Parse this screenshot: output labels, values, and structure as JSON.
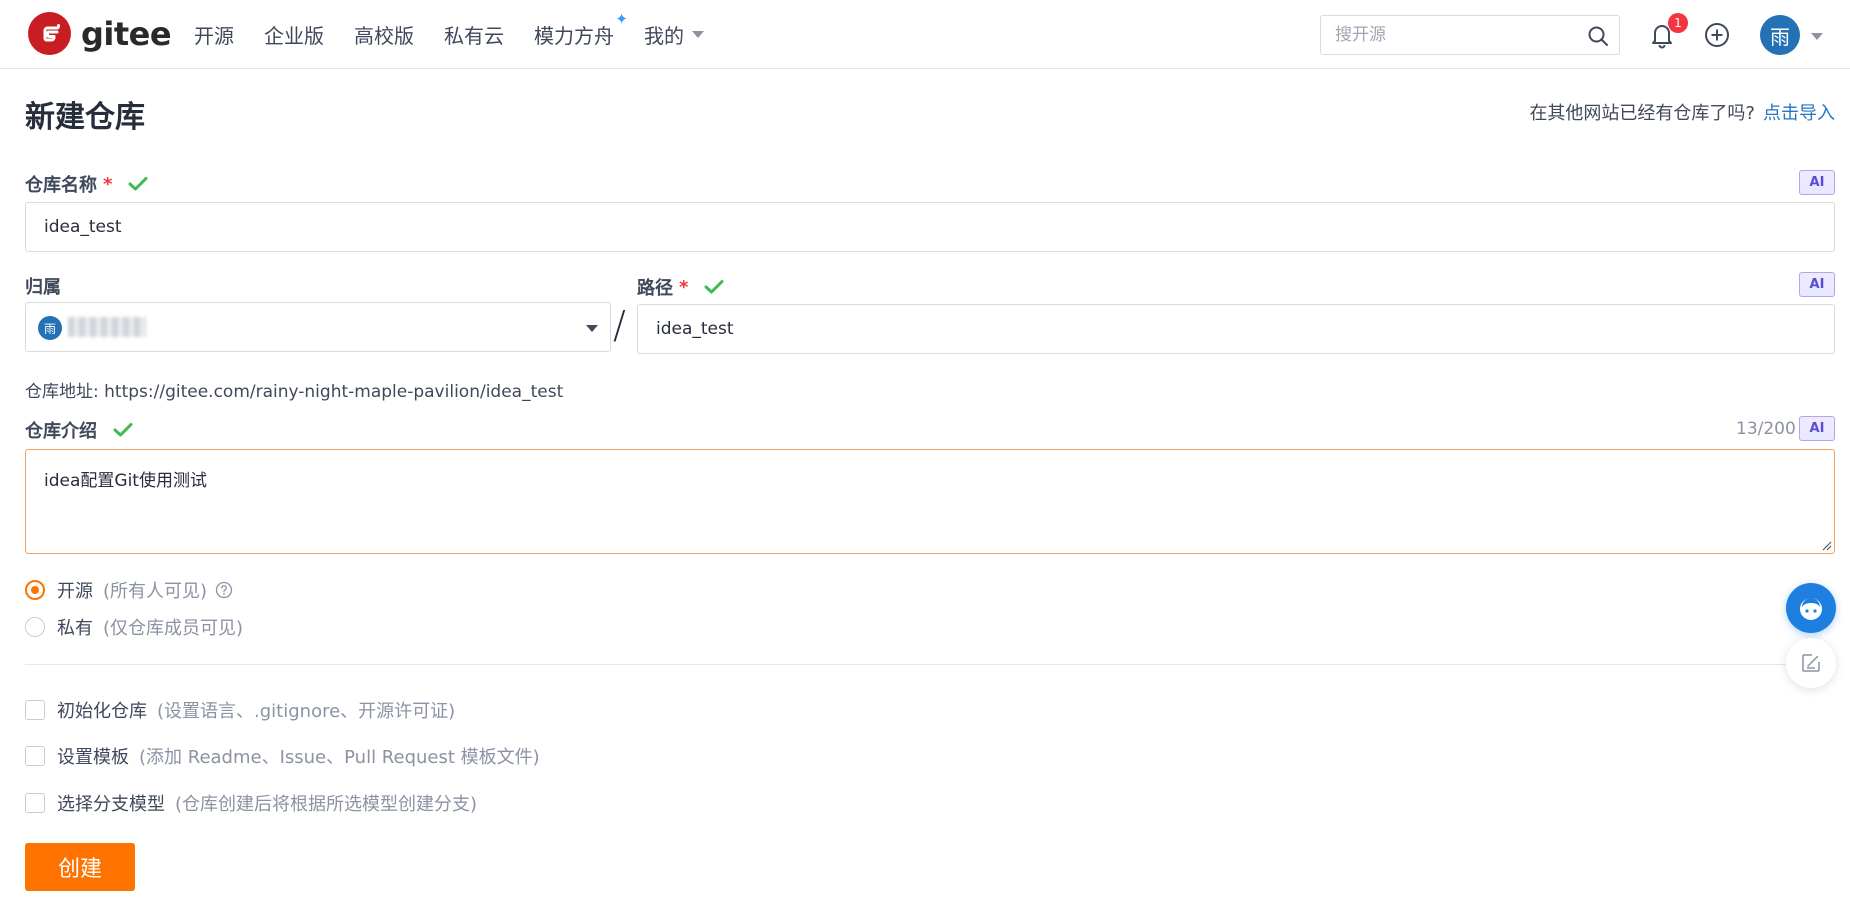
{
  "header": {
    "logo_text": "gitee",
    "nav": [
      {
        "label": "开源"
      },
      {
        "label": "企业版"
      },
      {
        "label": "高校版"
      },
      {
        "label": "私有云"
      },
      {
        "label": "模力方舟",
        "spark": "✦"
      },
      {
        "label": "我的"
      }
    ],
    "search_placeholder": "搜开源",
    "notification_count": "1",
    "user_avatar_text": "雨"
  },
  "page": {
    "title": "新建仓库",
    "import_hint": "在其他网站已经有仓库了吗?",
    "import_link": "点击导入"
  },
  "form": {
    "ai_tag": "AI",
    "repo_name": {
      "label": "仓库名称",
      "required": "*",
      "value": "idea_test"
    },
    "owner": {
      "label": "归属",
      "avatar_text": "雨"
    },
    "slash": "/",
    "path": {
      "label": "路径",
      "required": "*",
      "value": "idea_test"
    },
    "repo_url": "仓库地址: https://gitee.com/rainy-night-maple-pavilion/idea_test",
    "description": {
      "label": "仓库介绍",
      "value": "idea配置Git使用测试",
      "counter": "13/200"
    },
    "visibility": [
      {
        "label": "开源",
        "hint": "(所有人可见)",
        "selected": true
      },
      {
        "label": "私有",
        "hint": "(仅仓库成员可见)",
        "selected": false
      }
    ],
    "options": [
      {
        "label": "初始化仓库",
        "hint": "(设置语言、.gitignore、开源许可证)"
      },
      {
        "label": "设置模板",
        "hint": "(添加 Readme、Issue、Pull Request 模板文件)"
      },
      {
        "label": "选择分支模型",
        "hint": "(仓库创建后将根据所选模型创建分支)"
      }
    ],
    "submit_label": "创建"
  },
  "colors": {
    "brand_red": "#c71d23",
    "primary_orange": "#fe7300",
    "link_blue": "#2674c2",
    "valid_green": "#3fb950"
  },
  "icons": [
    "gitee-logo-icon",
    "search-icon",
    "bell-icon",
    "plus-circle-icon",
    "check-icon",
    "help-circle-icon",
    "caret-down-icon",
    "ai-assistant-icon",
    "feedback-edit-icon"
  ]
}
